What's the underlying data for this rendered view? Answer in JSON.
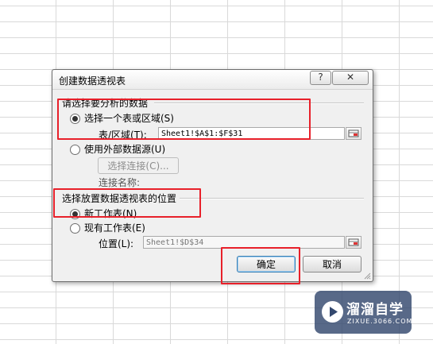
{
  "dialog": {
    "title": "创建数据透视表",
    "help_label": "?",
    "close_label": "✕"
  },
  "section_data": {
    "label": "请选择要分析的数据",
    "option_range": "选择一个表或区域(S)",
    "range_label": "表/区域(T):",
    "range_value": "Sheet1!$A$1:$F$31",
    "option_external": "使用外部数据源(U)",
    "choose_connection": "选择连接(C)...",
    "connection_name_label": "连接名称:"
  },
  "section_location": {
    "label": "选择放置数据透视表的位置",
    "option_new": "新工作表(N)",
    "option_existing": "现有工作表(E)",
    "location_label": "位置(L):",
    "location_value": "Sheet1!$D$34"
  },
  "buttons": {
    "ok": "确定",
    "cancel": "取消"
  },
  "watermark": {
    "title": "溜溜自学",
    "subtitle": "ZIXUE.3066.COM"
  },
  "colors": {
    "highlight": "#e8202a",
    "dialog_bg": "#f0f0f0"
  }
}
